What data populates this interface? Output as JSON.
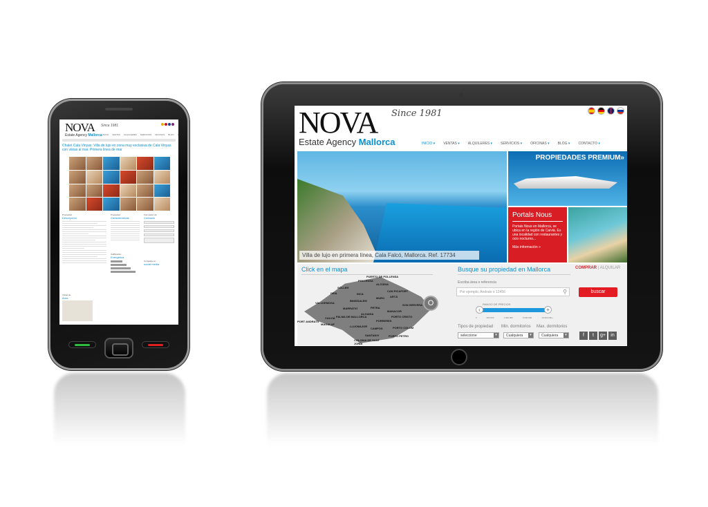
{
  "site": {
    "brand": "NOVA",
    "since": "Since 1981",
    "subtitle_plain": "Estate Agency",
    "subtitle_accent": "Mallorca",
    "flags": [
      "es-flag",
      "de-flag",
      "gb-flag",
      "ru-flag"
    ],
    "colors": {
      "accent": "#0a8fd0",
      "red": "#d81e24"
    },
    "nav": [
      "INICIO",
      "VENTAS",
      "ALQUILERES",
      "SERVICIOS",
      "OFICINAS",
      "BLOG",
      "CONTACTO"
    ]
  },
  "tablet": {
    "hero_caption": "Villa de lujo en primera línea, Cala Falcó, Mallorca. Ref. 17734",
    "premium_title": "PROPIEDADES PREMIUM»",
    "portals": {
      "title": "Portals Nous",
      "desc": "Portals Nous en Mallorca, se ubica en la región de Calvià. Es una localidad con restaurantes y ocio nocturno...",
      "more": "Más información »"
    },
    "map_heading": "Click en el mapa",
    "search_heading": "Busque su propiedad en Mallorca",
    "buy": "COMPRAR",
    "rent": "ALQUILAR",
    "ref_label": "Escriba área o referencia",
    "ref_placeholder": "Por ejemplo, Andratx o 12456",
    "search_button": "buscar",
    "price_label": "RANGO DE PRECIOS",
    "price_ticks": [
      "0",
      "500.000",
      "1.000.000",
      "5.000.000",
      "10.000.000+"
    ],
    "filters": [
      {
        "label": "Tipos de propiedad",
        "value": "seleccione"
      },
      {
        "label": "Min. dormitorios",
        "value": "Cualquiera"
      },
      {
        "label": "Max. dormitorios",
        "value": "Cualquiera"
      }
    ],
    "towns": [
      "PUERTO DE POLLENSA",
      "POLLENSA",
      "ALCÚDIA",
      "SÓLLER",
      "DEIA",
      "INCA",
      "CAN PICAFORT",
      "VALLDEMOSA",
      "BINISSALEM",
      "MURO",
      "ARTÁ",
      "MARRATXÍ",
      "PETRA",
      "SON SERVERA",
      "MANACOR",
      "ALGAIDA",
      "PORTO CRISTO",
      "CALVIÁ",
      "PALMA DE MALLORCA",
      "PORT ANDRATX",
      "MAGALUF",
      "LLUCMAJOR",
      "PORRERES",
      "CAMPOS",
      "PORTO COLOM",
      "SANTANYI",
      "PORTO PETRO",
      "COLONIA DE SANT JORDI"
    ],
    "social": [
      "f",
      "t",
      "g+",
      "in"
    ]
  },
  "phone": {
    "listing_title": "Chalet Cala Vinyas: Villa de lujo en zona muy exclusiva de Cala Vinyas con vistas al mar. Primera línea de mar",
    "cols": [
      {
        "kicker": "Propiedad",
        "title": "Descripción"
      },
      {
        "kicker": "Propiedad",
        "title": "Características"
      },
      {
        "kicker": "Formulario de",
        "title": "Contacto"
      }
    ],
    "energy": {
      "kicker": "Calificación",
      "title": "Energética"
    },
    "social": {
      "kicker": "Comparte en",
      "title": "social media"
    },
    "area": {
      "kicker": "Vistas de",
      "title": "Área"
    }
  }
}
